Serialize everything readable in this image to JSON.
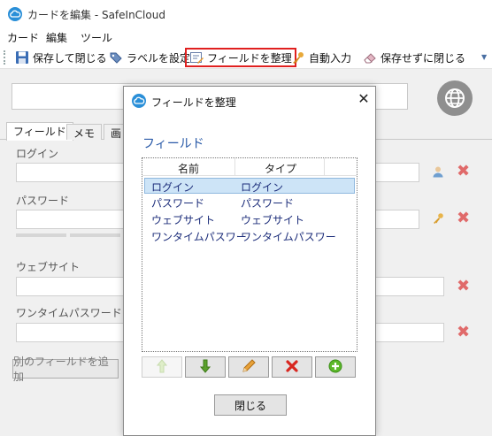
{
  "window": {
    "title": "カードを編集 - SafeInCloud"
  },
  "menu": [
    "カード",
    "編集",
    "ツール"
  ],
  "toolbar": {
    "save_close": "保存して閉じる",
    "label_settings": "ラベルを設定",
    "organize_fields": "フィールドを整理",
    "autofill": "自動入力",
    "close_without_save": "保存せずに閉じる"
  },
  "tabs": [
    "フィールド",
    "メモ",
    "画"
  ],
  "fields": {
    "login": "ログイン",
    "password": "パスワード",
    "website": "ウェブサイト",
    "otp": "ワンタイムパスワード"
  },
  "add_field_button": "別のフィールドを追加",
  "dialog": {
    "title": "フィールドを整理",
    "heading": "フィールド",
    "columns": [
      "名前",
      "タイプ"
    ],
    "rows": [
      {
        "name": "ログイン",
        "type": "ログイン"
      },
      {
        "name": "パスワード",
        "type": "パスワード"
      },
      {
        "name": "ウェブサイト",
        "type": "ウェブサイト"
      },
      {
        "name": "ワンタイムパスワー",
        "type": "ワンタイムパスワー"
      }
    ],
    "selected_row": 0,
    "close_button": "閉じる"
  },
  "colors": {
    "accent_blue": "#2a8fd8",
    "highlight_red": "#e0201f",
    "delete_red": "#e06a6a",
    "selection": "#cde4f7",
    "list_text": "#1c2d7a"
  },
  "icons": {
    "app": "safeincloud-cloud-icon",
    "save": "floppy-disk-icon",
    "label": "tag-icon",
    "organize": "edit-list-icon",
    "autofill": "key-icon",
    "discard": "eraser-icon",
    "globe": "globe-icon",
    "user": "user-icon",
    "move_up": "arrow-up-icon",
    "move_down": "arrow-down-icon",
    "rename": "pencil-icon",
    "delete": "red-x-icon",
    "add": "green-plus-icon"
  }
}
